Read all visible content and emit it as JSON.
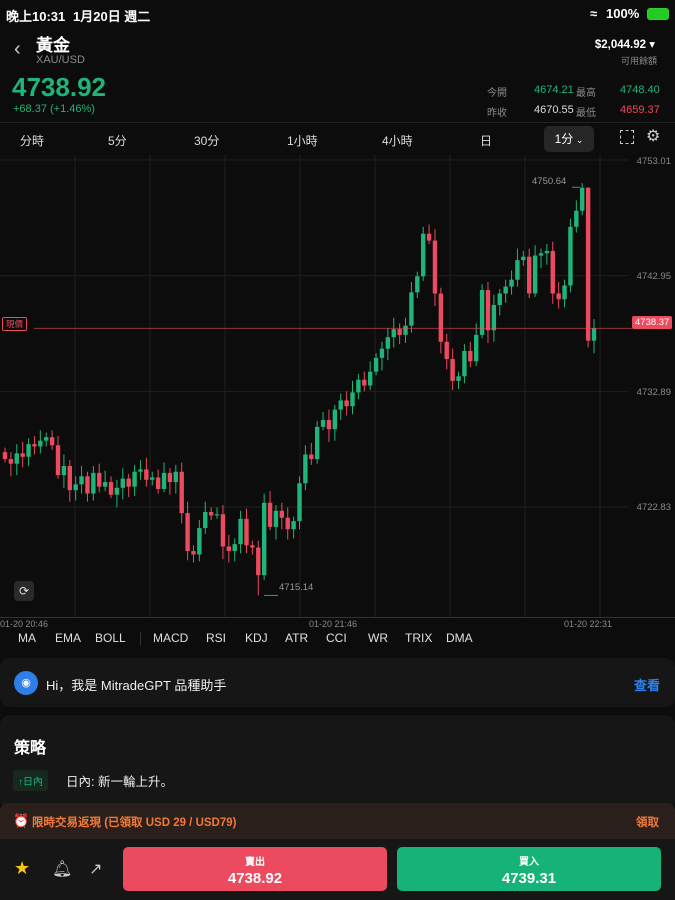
{
  "status_bar": {
    "time": "晚上10:31",
    "date": "1月20日 週二",
    "battery": "100%"
  },
  "header": {
    "title": "黃金",
    "symbol": "XAU/USD",
    "balance": "$2,044.92",
    "balance_label": "可用餘額"
  },
  "quote": {
    "price": "4738.92",
    "change": "+68.37 (+1.46%)",
    "open_label": "今開",
    "open": "4674.21",
    "high_label": "最高",
    "high": "4748.40",
    "prev_label": "昨收",
    "prev": "4670.55",
    "low_label": "最低",
    "low": "4659.37"
  },
  "tabs": [
    "分時",
    "5分",
    "30分",
    "1小時",
    "4小時",
    "日"
  ],
  "selected_interval": "1分",
  "indicators": [
    "MA",
    "EMA",
    "BOLL",
    "MACD",
    "RSI",
    "KDJ",
    "ATR",
    "CCI",
    "WR",
    "TRIX",
    "DMA"
  ],
  "gpt": {
    "text": "Hi，我是 MitradeGPT 品種助手",
    "link": "查看"
  },
  "strategy": {
    "title": "策略",
    "tag": "日內",
    "text": "日內: 新一輪上升。"
  },
  "promo": {
    "text": "限時交易返現 (已領取 USD 29 / USD79)",
    "action": "領取"
  },
  "trade": {
    "sell_label": "賣出",
    "sell_price": "4738.92",
    "buy_label": "買入",
    "buy_price": "4739.31"
  },
  "colors": {
    "up": "#1fb57a",
    "down": "#ec4a5e",
    "accent": "#2f80ed",
    "promo": "#f07a3a"
  },
  "chart_data": {
    "type": "candlestick",
    "y_ticks": [
      "4753.01",
      "4742.95",
      "4732.89",
      "4722.83"
    ],
    "ylim": [
      4712.5,
      4753.5
    ],
    "x_labels": [
      "01-20 20:46",
      "01-20 21:46",
      "01-20 22:31"
    ],
    "current_price_label": "現價",
    "current_price": "4738.37",
    "max_label": "4750.64",
    "min_label": "4715.14",
    "first_open": 4727.6,
    "closes": [
      4727.0,
      4726.6,
      4727.5,
      4727.2,
      4728.3,
      4728.1,
      4728.6,
      4728.9,
      4728.2,
      4725.6,
      4726.4,
      4724.3,
      4724.8,
      4725.5,
      4724.0,
      4725.8,
      4724.6,
      4725.0,
      4723.9,
      4724.5,
      4725.3,
      4724.6,
      4725.9,
      4726.1,
      4725.2,
      4725.4,
      4724.4,
      4725.8,
      4725.0,
      4725.9,
      4722.3,
      4719.0,
      4718.7,
      4721.0,
      4722.4,
      4722.1,
      4722.2,
      4719.4,
      4719.0,
      4719.6,
      4721.8,
      4719.5,
      4719.3,
      4716.9,
      4723.2,
      4721.1,
      4722.5,
      4721.9,
      4720.9,
      4721.6,
      4724.9,
      4727.4,
      4727.0,
      4729.8,
      4730.4,
      4729.6,
      4731.3,
      4732.1,
      4731.6,
      4732.8,
      4733.9,
      4733.4,
      4734.6,
      4735.8,
      4736.6,
      4737.6,
      4738.3,
      4737.8,
      4738.6,
      4741.5,
      4742.9,
      4746.6,
      4746.0,
      4741.4,
      4737.2,
      4735.7,
      4733.8,
      4734.2,
      4736.4,
      4735.5,
      4737.8,
      4741.7,
      4738.2,
      4740.4,
      4741.4,
      4742.0,
      4742.6,
      4744.3,
      4744.6,
      4741.4,
      4744.7,
      4744.9,
      4745.1,
      4741.4,
      4740.9,
      4742.1,
      4747.2,
      4748.6,
      4750.6,
      4737.3,
      4738.37
    ]
  }
}
